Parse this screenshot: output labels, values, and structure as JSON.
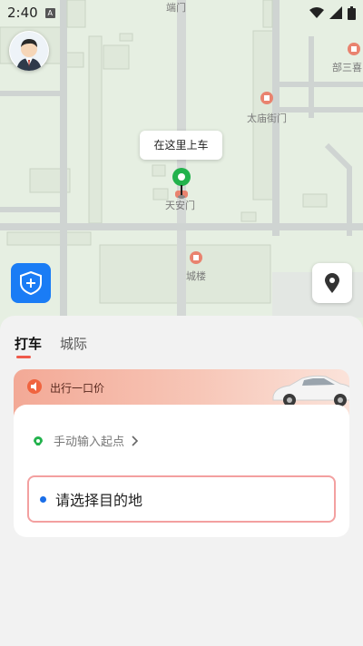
{
  "status_bar": {
    "time": "2:40",
    "notification_badge": "A"
  },
  "map": {
    "labels": {
      "top_gate": "端门",
      "east_dept": "部三喜",
      "temple_gate": "太庙街门",
      "tiananmen": "天安门",
      "gate_tower": "城楼"
    },
    "pickup_callout": "在这里上车"
  },
  "panel": {
    "tabs": [
      {
        "label": "打车",
        "active": true
      },
      {
        "label": "城际",
        "active": false
      }
    ],
    "promo_text": "出行一口价",
    "start_placeholder": "手动输入起点",
    "destination_placeholder": "请选择目的地"
  },
  "colors": {
    "accent_red": "#ef5a4b",
    "brand_blue": "#1a7cf5",
    "pin_green": "#22b24c",
    "dest_border": "#f3a0a0"
  },
  "icons": {
    "avatar": "user-avatar",
    "shield": "safety-shield-icon",
    "locate": "location-pin-icon",
    "speaker": "speaker-icon",
    "start": "green-dot-icon",
    "chevron": "chevron-right-icon"
  }
}
